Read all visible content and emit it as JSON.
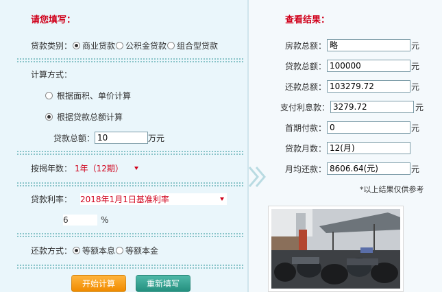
{
  "left": {
    "title": "请您填写：",
    "loan_type": {
      "label": "贷款类别：",
      "options": [
        "商业贷款",
        "公积金贷款",
        "组合型贷款"
      ],
      "selected": "商业贷款"
    },
    "calc_method": {
      "label": "计算方式：",
      "option_area": "根据面积、单价计算",
      "option_total": "根据贷款总额计算",
      "selected": "根据贷款总额计算",
      "total_label": "贷款总额：",
      "total_value": "10",
      "total_unit": "万元"
    },
    "years": {
      "label": "按揭年数：",
      "value": "1年（12期）"
    },
    "rate": {
      "label": "贷款利率：",
      "value": "2018年1月1日基准利率",
      "number": "6",
      "unit": "%"
    },
    "repay": {
      "label": "还款方式：",
      "options": [
        "等额本息",
        "等额本金"
      ],
      "selected": "等额本息"
    },
    "buttons": {
      "start": "开始计算",
      "reset": "重新填写"
    }
  },
  "right": {
    "title": "查看结果：",
    "rows": [
      {
        "label": "房款总额：",
        "value": "略",
        "unit": "元"
      },
      {
        "label": "贷款总额：",
        "value": "100000",
        "unit": "元"
      },
      {
        "label": "还款总额：",
        "value": "103279.72",
        "unit": "元"
      },
      {
        "label": "支付利息款：",
        "value": "3279.72",
        "unit": "元"
      },
      {
        "label": "首期付款：",
        "value": "0",
        "unit": "元"
      },
      {
        "label": "贷款月数：",
        "value": "12(月)",
        "unit": ""
      },
      {
        "label": "月均还款：",
        "value": "8606.64(元)",
        "unit": "元"
      }
    ],
    "note": "*以上结果仅供参考"
  },
  "colors": {
    "title_red": "#d0011b",
    "left_bg": "#eaf6fb",
    "dotted": "#89c4c9",
    "start_button": "#f08b00",
    "reset_button": "#25907f"
  }
}
